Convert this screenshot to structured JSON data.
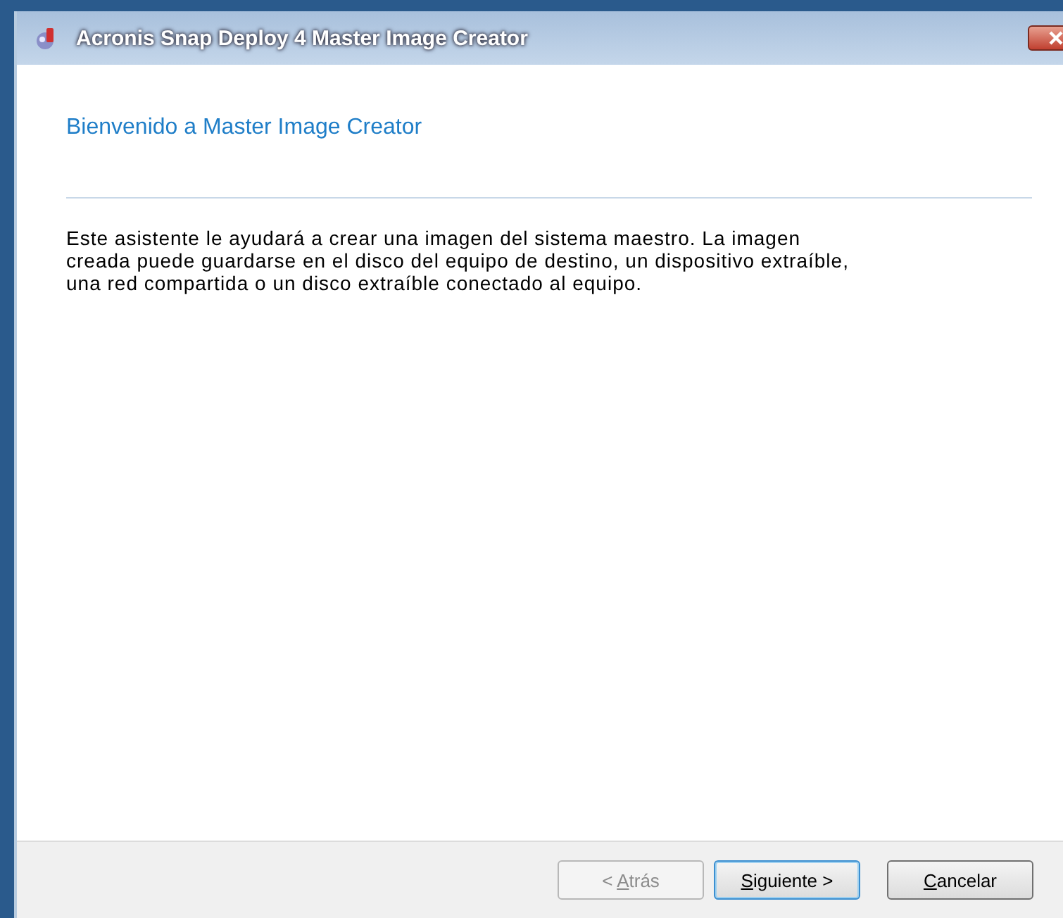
{
  "window": {
    "title": "Acronis Snap Deploy 4 Master Image Creator"
  },
  "heading": "Bienvenido a Master Image Creator",
  "description": "Este asistente le ayudará a crear una imagen del sistema maestro. La imagen creada puede guardarse en el disco del equipo de destino, un dispositivo extraíble, una red compartida o un disco extraíble conectado al equipo.",
  "buttons": [
    {
      "before": "< ",
      "key": "A",
      "after": "trás",
      "disabled": true,
      "default": false
    },
    {
      "key": "S",
      "after": "iguiente >",
      "disabled": false,
      "default": true
    },
    {
      "key": "C",
      "after": "ancelar",
      "disabled": false,
      "default": false
    }
  ]
}
